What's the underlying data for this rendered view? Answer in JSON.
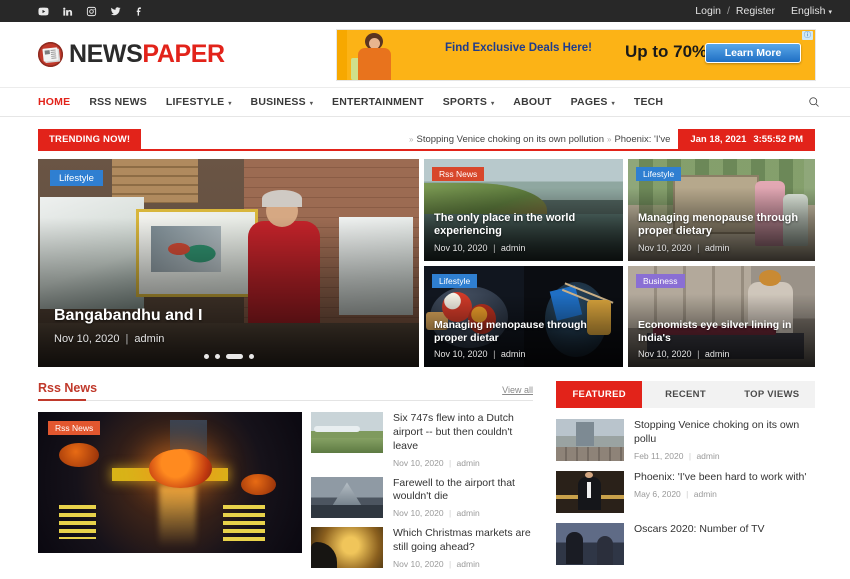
{
  "topbar": {
    "social": [
      {
        "name": "youtube-icon",
        "label": "YouTube"
      },
      {
        "name": "linkedin-icon",
        "label": "LinkedIn"
      },
      {
        "name": "instagram-icon",
        "label": "Instagram"
      },
      {
        "name": "twitter-icon",
        "label": "Twitter"
      },
      {
        "name": "facebook-icon",
        "label": "Facebook"
      }
    ],
    "login": "Login",
    "separator": "/",
    "register": "Register",
    "language": "English",
    "caret": "▾"
  },
  "brand": {
    "name_dark": "NEWS",
    "name_red": "PAPER",
    "accent": "#e2231a"
  },
  "ad": {
    "headline": "Find Exclusive Deals Here!",
    "offer": "Up to 70% off!",
    "cta": "Learn More",
    "info_glyph": "ⓘ",
    "bg_color": "#fcb316"
  },
  "nav": {
    "items": [
      {
        "label": "HOME",
        "active": true,
        "dropdown": false
      },
      {
        "label": "RSS NEWS",
        "active": false,
        "dropdown": false
      },
      {
        "label": "LIFESTYLE",
        "active": false,
        "dropdown": true
      },
      {
        "label": "BUSINESS",
        "active": false,
        "dropdown": true
      },
      {
        "label": "ENTERTAINMENT",
        "active": false,
        "dropdown": false
      },
      {
        "label": "SPORTS",
        "active": false,
        "dropdown": true
      },
      {
        "label": "ABOUT",
        "active": false,
        "dropdown": false
      },
      {
        "label": "PAGES",
        "active": false,
        "dropdown": true
      },
      {
        "label": "TECH",
        "active": false,
        "dropdown": false
      }
    ],
    "caret": "▾",
    "search_icon": "search-icon"
  },
  "trending": {
    "label": "TRENDING NOW!",
    "ticker_items": [
      "Stopping Venice choking on its own pollution",
      "Phoenix: 'I've"
    ],
    "bullet": "»",
    "date": "Jan 18, 2021",
    "time": "3:55:52 PM"
  },
  "hero": {
    "main": {
      "badge": "Lifestyle",
      "badge_type": "lifestyle",
      "title": "Bangabandhu and I",
      "date": "Nov 10, 2020",
      "author": "admin",
      "dots": [
        false,
        false,
        true,
        false
      ]
    },
    "cards": [
      {
        "badge": "Rss News",
        "badge_type": "rss",
        "title": "The only place in the world experiencing",
        "date": "Nov 10, 2020",
        "author": "admin",
        "art": "art-coast"
      },
      {
        "badge": "Lifestyle",
        "badge_type": "lifestyle",
        "title": "Managing menopause through proper dietary",
        "date": "Nov 10, 2020",
        "author": "admin",
        "art": "art-tree"
      },
      {
        "badge": "Lifestyle",
        "badge_type": "lifestyle",
        "title": "Managing menopause through proper dietar",
        "date": "Nov 10, 2020",
        "author": "admin",
        "art": "art-food"
      },
      {
        "badge": "",
        "badge_type": "",
        "title": "",
        "date": "",
        "author": "",
        "art": "art-food2"
      },
      {
        "badge": "Business",
        "badge_type": "business",
        "title": "Economists eye silver lining in India's",
        "date": "Nov 10, 2020",
        "author": "admin",
        "art": "art-street"
      }
    ],
    "meta_separator": "|"
  },
  "rss_section": {
    "title": "Rss News",
    "view_all": "View all",
    "feature": {
      "badge": "Rss News",
      "art": "art-pumpkin"
    },
    "items": [
      {
        "title": "Six 747s flew into a Dutch airport -- but then couldn't leave",
        "date": "Nov 10, 2020",
        "author": "admin",
        "art": "art-planes"
      },
      {
        "title": "Farewell to the airport that wouldn't die",
        "date": "Nov 10, 2020",
        "author": "admin",
        "art": "art-airport"
      },
      {
        "title": "Which Christmas markets are still going ahead?",
        "date": "Nov 10, 2020",
        "author": "admin",
        "art": "art-market"
      }
    ],
    "meta_separator": "|"
  },
  "sidebar": {
    "tabs": [
      {
        "label": "FEATURED",
        "active": true
      },
      {
        "label": "RECENT",
        "active": false
      },
      {
        "label": "TOP VIEWS",
        "active": false
      }
    ],
    "items": [
      {
        "title": "Stopping Venice choking on its own pollu",
        "date": "Feb 11, 2020",
        "author": "admin",
        "art": "art-venice"
      },
      {
        "title": "Phoenix: 'I've been hard to work with'",
        "date": "May 6, 2020",
        "author": "admin",
        "art": "art-tux"
      },
      {
        "title": "Oscars 2020: Number of TV",
        "date": "",
        "author": "",
        "art": "art-oscars"
      }
    ],
    "meta_separator": "|"
  }
}
